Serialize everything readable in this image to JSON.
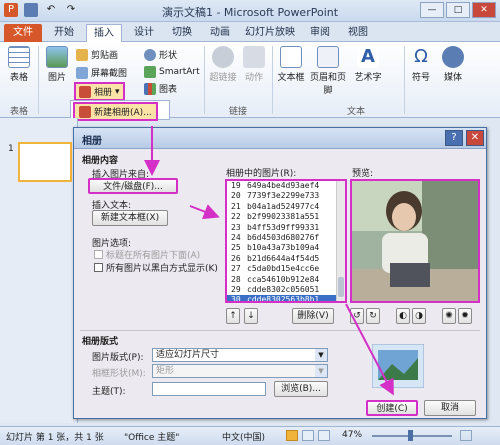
{
  "app": {
    "title": "演示文稿1 - Microsoft PowerPoint",
    "window_buttons": [
      "—",
      "□",
      "✕"
    ]
  },
  "tabs": [
    "文件",
    "开始",
    "插入",
    "设计",
    "切换",
    "动画",
    "幻灯片放映",
    "审阅",
    "视图"
  ],
  "ribbon": {
    "table": "表格",
    "picture": "图片",
    "clipart": "剪贴画",
    "screenshot": "屏幕截图",
    "album": "相册",
    "shapes": "形状",
    "smartart": "SmartArt",
    "chart": "图表",
    "hyperlink": "超链接",
    "action": "动作",
    "textbox": "文本框",
    "header_footer": "页眉和页脚",
    "wordart": "艺术字",
    "symbol": "符号",
    "media": "媒体",
    "groups": {
      "tables": "表格",
      "links": "链接",
      "text": "文本"
    },
    "album_menu_item": "新建相册(A)..."
  },
  "left_pane": {
    "slide_number": "1"
  },
  "dialog": {
    "title": "相册",
    "help": "?",
    "close": "✕",
    "section_content": "相册内容",
    "insert_from_label": "插入图片来自:",
    "file_disk_button": "文件/磁盘(F)...",
    "insert_text_label": "插入文本:",
    "new_textbox_button": "新建文本框(X)",
    "picture_options_label": "图片选项:",
    "caption_option": "标题在所有图片下面(A)",
    "bw_option": "所有图片以黑白方式显示(K)",
    "list_label": "相册中的图片(R):",
    "preview_label": "预览:",
    "pictures": [
      {
        "n": "19",
        "file": "649a4be4d93aef4"
      },
      {
        "n": "20",
        "file": "7739f3e2299e733"
      },
      {
        "n": "21",
        "file": "b04a1ad524977c4"
      },
      {
        "n": "22",
        "file": "b2f99023381a551"
      },
      {
        "n": "23",
        "file": "b4ff53d9ff99331"
      },
      {
        "n": "24",
        "file": "b6d4503d680276f"
      },
      {
        "n": "25",
        "file": "b10a43a73b109a4"
      },
      {
        "n": "26",
        "file": "b21d6644a4f54d5"
      },
      {
        "n": "27",
        "file": "c5da0bd15e4cc6e"
      },
      {
        "n": "28",
        "file": "cca54610b912e84"
      },
      {
        "n": "29",
        "file": "cdde8302c056051"
      },
      {
        "n": "30",
        "file": "cdde8302563b8b1"
      }
    ],
    "remove_button": "删除(V)",
    "layout_section": "相册版式",
    "picture_layout_label": "图片版式(P):",
    "picture_layout_value": "适应幻灯片尺寸",
    "frame_shape_label": "相框形状(M):",
    "frame_shape_value": "矩形",
    "theme_label": "主题(T):",
    "browse_button": "浏览(B)...",
    "create_button": "创建(C)",
    "cancel_button": "取消"
  },
  "statusbar": {
    "slide_info": "幻灯片 第 1 张，共 1 张",
    "theme": "\"Office 主题\"",
    "language": "中文(中国)",
    "zoom": "47%"
  },
  "colors": {
    "highlight": "#d42fc6",
    "file_tab": "#d6582a",
    "selected_row": "#3b6fc5"
  }
}
